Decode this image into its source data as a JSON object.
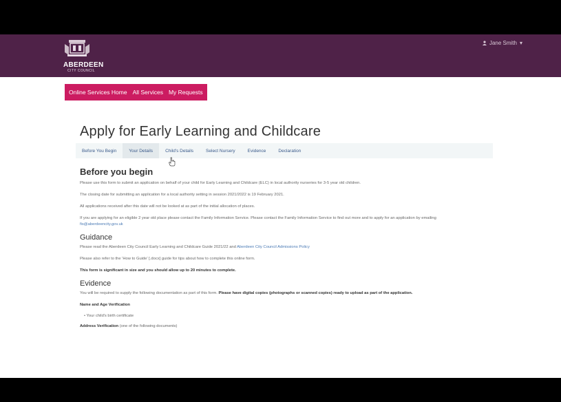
{
  "header": {
    "logo_text": "ABERDEEN",
    "logo_subtext": "CITY COUNCIL",
    "user_name": "Jane Smith"
  },
  "nav": {
    "items": [
      {
        "label": "Online Services Home"
      },
      {
        "label": "All Services"
      },
      {
        "label": "My Requests"
      }
    ]
  },
  "page": {
    "title": "Apply for Early Learning and Childcare"
  },
  "tabs": [
    {
      "label": "Before You Begin"
    },
    {
      "label": "Your Details"
    },
    {
      "label": "Child's Details"
    },
    {
      "label": "Select Nursery"
    },
    {
      "label": "Evidence"
    },
    {
      "label": "Declaration"
    }
  ],
  "content": {
    "heading_before": "Before you begin",
    "p1": "Please use this form to submit an application on behalf of your child for Early Learning and Childcare (ELC) in local authority nurseries for 3-5 year old children.",
    "p2": "The closing date for submitting an application for a local authority setting in session 2021/2022 is 19 February 2021.",
    "p3": "All applications received after this date will not be looked at as part of the initial allocation of places.",
    "p4": "If you are applying for an eligible 2 year old place please contact the Family Information Service. Please contact the Family Information Service to find out more and to apply for an application by emailing",
    "p4_link": "fis@aberdeencity.gov.uk",
    "heading_guidance": "Guidance",
    "p5": "Please read the Aberdeen City Council Early Learning and Childcare Guide 2021/22 and",
    "p5_link": "Aberdeen City Council Admissions Policy",
    "p6": "Please also refer to the 'How to Guide' [.docx] guide for tips about how to complete this online form.",
    "p7": "This form is significant in size and you should allow up to 20 minutes to complete.",
    "heading_evidence": "Evidence",
    "p8": "You will be required to supply the following documentation as part of this form.",
    "p8_bold": "Please have digital copies (photographs or scanned copies) ready to upload as part of the application.",
    "name_age_heading": "Name and Age Verification",
    "li1": "Your child's birth certificate",
    "address_heading": "Address Verification",
    "address_note": "(one of the following documents)"
  }
}
